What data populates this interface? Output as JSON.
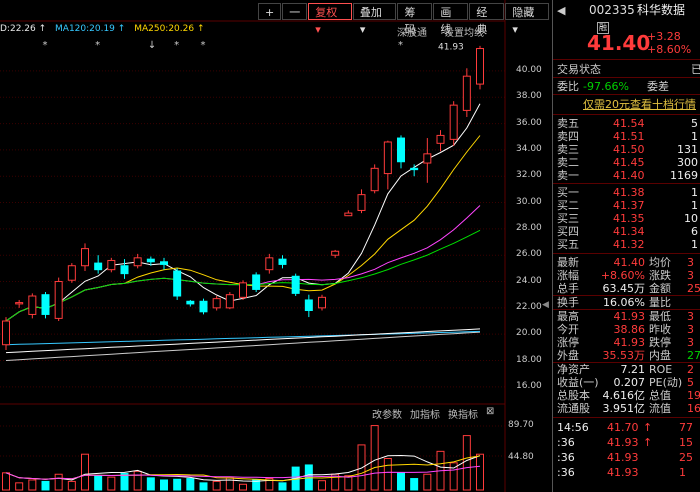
{
  "toolbar": {
    "plus": "+",
    "minus": "一",
    "adjust": "复权",
    "overlay": "叠加",
    "chips": "筹码",
    "draw": "画线",
    "classic": "经典",
    "hide": "隐藏",
    "dropdown": "▾"
  },
  "legend": {
    "ma1": "D:22.26 ↑",
    "ma120": "MA120:20.19 ↑",
    "ma250": "MA250:20.26 ↑",
    "ma1_color": "#e8e8e8",
    "ma120_color": "#36c8ff",
    "ma250_color": "#ffd700"
  },
  "subpanel": {
    "deep": "深股通",
    "setma": "设置均线"
  },
  "markers": [
    "*",
    "*",
    "↓",
    "*",
    "*",
    "*",
    "*"
  ],
  "peak_label": "41.93",
  "price_axis": [
    "40.00",
    "38.00",
    "36.00",
    "34.00",
    "32.00",
    "30.00",
    "28.00",
    "26.00",
    "24.00",
    "22.00",
    "20.00",
    "18.00",
    "16.00"
  ],
  "vol_toolbar": {
    "params": "改参数",
    "add": "加指标",
    "swap": "换指标",
    "close": "⊠"
  },
  "vol_axis": [
    "89.70",
    "44.80"
  ],
  "side": {
    "collapse": "◀"
  },
  "panel": {
    "code": "002335",
    "name": "科华数据",
    "tag": "融",
    "price": "41.40",
    "change": "+3.28",
    "pct": "+8.60%",
    "trade_status_label": "交易状态",
    "trade_status_extra": "已",
    "weibi_label": "委比",
    "weibi_val": "-97.66%",
    "weicha_label": "委差",
    "promo": "仅需20元查看十档行情",
    "sells": [
      {
        "label": "卖五",
        "price": "41.54",
        "vol": "5"
      },
      {
        "label": "卖四",
        "price": "41.51",
        "vol": "1"
      },
      {
        "label": "卖三",
        "price": "41.50",
        "vol": "131"
      },
      {
        "label": "卖二",
        "price": "41.45",
        "vol": "300"
      },
      {
        "label": "卖一",
        "price": "41.40",
        "vol": "1169"
      }
    ],
    "buys": [
      {
        "label": "买一",
        "price": "41.38",
        "vol": "1"
      },
      {
        "label": "买二",
        "price": "41.37",
        "vol": "1"
      },
      {
        "label": "买三",
        "price": "41.35",
        "vol": "10"
      },
      {
        "label": "买四",
        "price": "41.34",
        "vol": "6"
      },
      {
        "label": "买五",
        "price": "41.32",
        "vol": "1"
      }
    ],
    "stats": [
      {
        "l1": "最新",
        "v1": "41.40",
        "c1": "red",
        "l2": "均价",
        "v2": "3"
      },
      {
        "l1": "涨幅",
        "v1": "+8.60%",
        "c1": "red",
        "l2": "涨跌",
        "v2": "3"
      },
      {
        "l1": "总手",
        "v1": "63.45万",
        "c1": "wht",
        "l2": "金额",
        "v2": "25."
      },
      {
        "l1": "换手",
        "v1": "16.06%",
        "c1": "wht",
        "l2": "量比",
        "v2": ""
      },
      {
        "l1": "最高",
        "v1": "41.93",
        "c1": "red",
        "l2": "最低",
        "v2": "3"
      },
      {
        "l1": "今开",
        "v1": "38.86",
        "c1": "red",
        "l2": "昨收",
        "v2": "3"
      },
      {
        "l1": "涨停",
        "v1": "41.93",
        "c1": "red",
        "l2": "跌停",
        "v2": "3"
      },
      {
        "l1": "外盘",
        "v1": "35.53万",
        "c1": "red",
        "l2": "内盘",
        "v2": "27."
      },
      {
        "l1": "净资产",
        "v1": "7.21",
        "c1": "wht",
        "l2": "ROE",
        "v2": "2"
      },
      {
        "l1": "收益(一)",
        "v1": "0.207",
        "c1": "wht",
        "l2": "PE(动)",
        "v2": "5"
      },
      {
        "l1": "总股本",
        "v1": "4.616亿",
        "c1": "wht",
        "l2": "总值",
        "v2": "19"
      },
      {
        "l1": "流通股",
        "v1": "3.951亿",
        "c1": "wht",
        "l2": "流值",
        "v2": "16"
      }
    ],
    "ticks": [
      {
        "t": "14:56",
        "p": "41.70",
        "arrow": "↑",
        "v": "77"
      },
      {
        "t": ":36",
        "p": "41.93",
        "arrow": "↑",
        "v": "15"
      },
      {
        "t": ":36",
        "p": "41.93",
        "arrow": "",
        "v": "25"
      },
      {
        "t": ":36",
        "p": "41.93",
        "arrow": "",
        "v": "1"
      }
    ]
  },
  "chart_data": {
    "type": "candlestick",
    "ylim": [
      15,
      42.5
    ],
    "candles": [
      [
        19.2,
        21.0,
        18.8,
        21.3
      ],
      [
        22.3,
        22.4,
        22.0,
        22.6
      ],
      [
        21.5,
        22.9,
        21.2,
        23.1
      ],
      [
        23.0,
        21.5,
        21.2,
        23.2
      ],
      [
        21.2,
        24.0,
        21.0,
        24.3
      ],
      [
        24.1,
        25.2,
        23.9,
        25.4
      ],
      [
        25.2,
        26.5,
        24.8,
        26.9
      ],
      [
        25.4,
        24.9,
        24.6,
        26.0
      ],
      [
        24.9,
        25.6,
        24.7,
        25.8
      ],
      [
        25.2,
        24.6,
        24.2,
        25.7
      ],
      [
        25.2,
        25.8,
        25.0,
        26.1
      ],
      [
        25.7,
        25.5,
        25.2,
        25.9
      ],
      [
        25.5,
        25.3,
        24.9,
        25.8
      ],
      [
        24.8,
        22.9,
        22.6,
        25.0
      ],
      [
        22.5,
        22.3,
        22.1,
        22.6
      ],
      [
        22.5,
        21.7,
        21.5,
        22.7
      ],
      [
        22.0,
        22.7,
        21.8,
        22.9
      ],
      [
        22.0,
        23.0,
        21.9,
        23.2
      ],
      [
        22.8,
        23.9,
        22.6,
        24.1
      ],
      [
        24.5,
        23.4,
        23.2,
        24.7
      ],
      [
        24.9,
        25.8,
        24.6,
        26.1
      ],
      [
        25.7,
        25.3,
        25.0,
        26.0
      ],
      [
        24.4,
        23.1,
        22.9,
        24.6
      ],
      [
        22.6,
        21.8,
        21.3,
        23.0
      ],
      [
        22.0,
        22.8,
        21.8,
        23.0
      ],
      [
        26.0,
        26.3,
        25.8,
        26.4
      ],
      [
        29.0,
        29.2,
        29.0,
        29.4
      ],
      [
        29.4,
        30.6,
        29.2,
        31.0
      ],
      [
        30.9,
        32.6,
        30.7,
        32.9
      ],
      [
        32.2,
        34.6,
        31.0,
        34.7
      ],
      [
        34.9,
        33.1,
        32.6,
        35.1
      ],
      [
        32.6,
        32.5,
        32.0,
        32.9
      ],
      [
        33.0,
        33.7,
        31.5,
        34.9
      ],
      [
        34.5,
        35.1,
        33.9,
        35.5
      ],
      [
        34.8,
        37.4,
        34.3,
        37.7
      ],
      [
        37.0,
        39.6,
        36.5,
        40.2
      ],
      [
        39.0,
        41.7,
        38.6,
        41.9
      ]
    ],
    "volumes": [
      24,
      10,
      14,
      12,
      22,
      12,
      50,
      20,
      18,
      23,
      26,
      17,
      14,
      15,
      16,
      10,
      12,
      17,
      8,
      14,
      16,
      10,
      32,
      35,
      13,
      22,
      20,
      63,
      90,
      44,
      24,
      16,
      22,
      54,
      38,
      76,
      50
    ]
  }
}
